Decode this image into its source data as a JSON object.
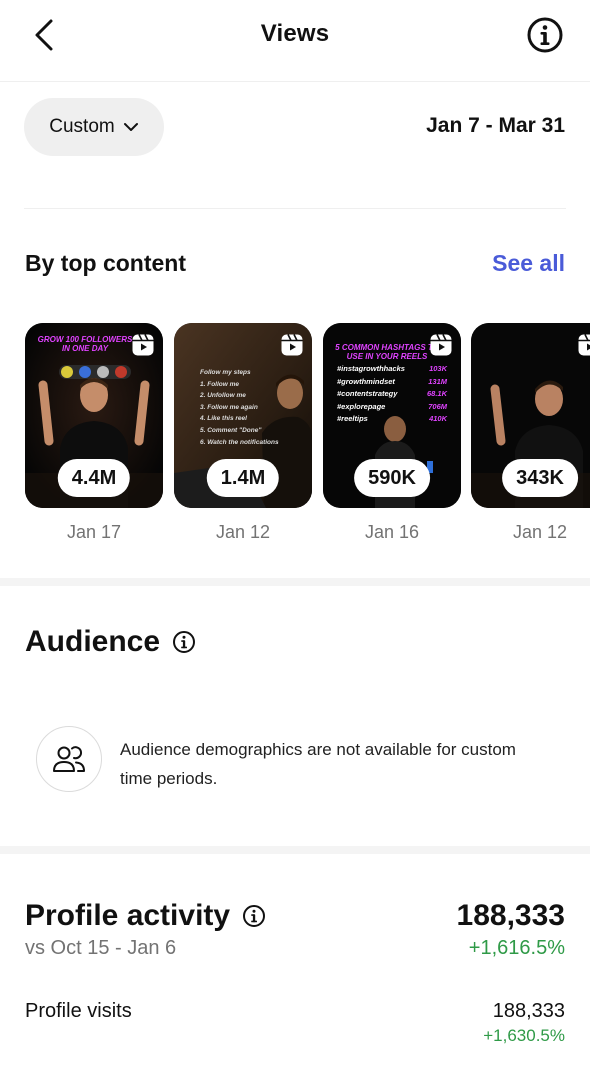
{
  "header": {
    "title": "Views",
    "back_icon": "chevron-left-icon",
    "info_icon": "info-icon"
  },
  "filter": {
    "period_label": "Custom",
    "period_icon": "chevron-down-icon",
    "date_range": "Jan 7 - Mar 31"
  },
  "top_content": {
    "heading": "By top content",
    "see_all": "See all",
    "reel_icon": "reels-icon",
    "items": [
      {
        "views": "4.4M",
        "date": "Jan 17",
        "overlay_title": "GROW 100 FOLLOWERS IN ONE DAY"
      },
      {
        "views": "1.4M",
        "date": "Jan 12",
        "overlay_lines": [
          "Follow my steps",
          "1. Follow me",
          "2. Unfollow me",
          "3. Follow me again",
          "4. Like this reel",
          "5. Comment \"Done\"",
          "6. Watch the notifications"
        ]
      },
      {
        "views": "590K",
        "date": "Jan 16",
        "overlay_title": "5 COMMON HASHTAGS TO USE IN YOUR REELS",
        "hashtags": [
          {
            "tag": "#instagrowthhacks",
            "count": "103K"
          },
          {
            "tag": "#growthmindset",
            "count": "131M"
          },
          {
            "tag": "#contentstrategy",
            "count": "68.1K"
          },
          {
            "tag": "#explorepage",
            "count": "706M"
          },
          {
            "tag": "#reeltips",
            "count": "410K"
          }
        ]
      },
      {
        "views": "343K",
        "date": "Jan 12"
      }
    ]
  },
  "audience": {
    "heading": "Audience",
    "info_icon": "info-icon",
    "demo_icon": "people-icon",
    "message": "Audience demographics are not available for custom time periods."
  },
  "profile_activity": {
    "heading": "Profile activity",
    "comparison": "vs Oct 15 - Jan 6",
    "total": "188,333",
    "total_change": "+1,616.5%",
    "rows": [
      {
        "label": "Profile visits",
        "value": "188,333",
        "change": "+1,630.5%"
      }
    ]
  },
  "colors": {
    "link": "#4a5bd8",
    "positive": "#2f9a47",
    "muted": "#737373",
    "accent_magenta": "#e043ff"
  }
}
